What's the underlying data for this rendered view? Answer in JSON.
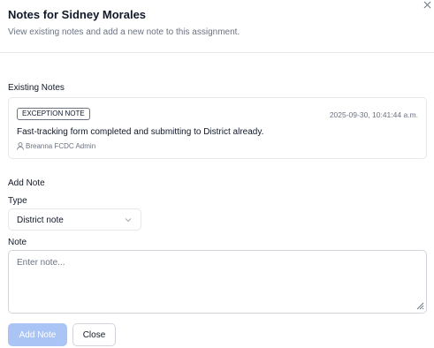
{
  "dialog": {
    "title": "Notes for Sidney Morales",
    "subtitle": "View existing notes and add a new note to this assignment.",
    "close_icon": "close-icon"
  },
  "existing_notes": {
    "label": "Existing Notes",
    "notes": [
      {
        "badge": "EXCEPTION NOTE",
        "timestamp": "2025-09-30, 10:41:44 a.m.",
        "text": "Fast-tracking form completed and submitting to District already.",
        "author": "Breanna FCDC Admin",
        "author_icon": "user-icon"
      }
    ]
  },
  "add_note": {
    "label": "Add Note",
    "type_label": "Type",
    "type_value": "District note",
    "note_label": "Note",
    "note_placeholder": "Enter note...",
    "note_value": ""
  },
  "actions": {
    "add_label": "Add Note",
    "close_label": "Close"
  },
  "colors": {
    "primary_disabled": "#a9c4f5",
    "border": "#e5e7eb",
    "muted_text": "#6b7280"
  }
}
